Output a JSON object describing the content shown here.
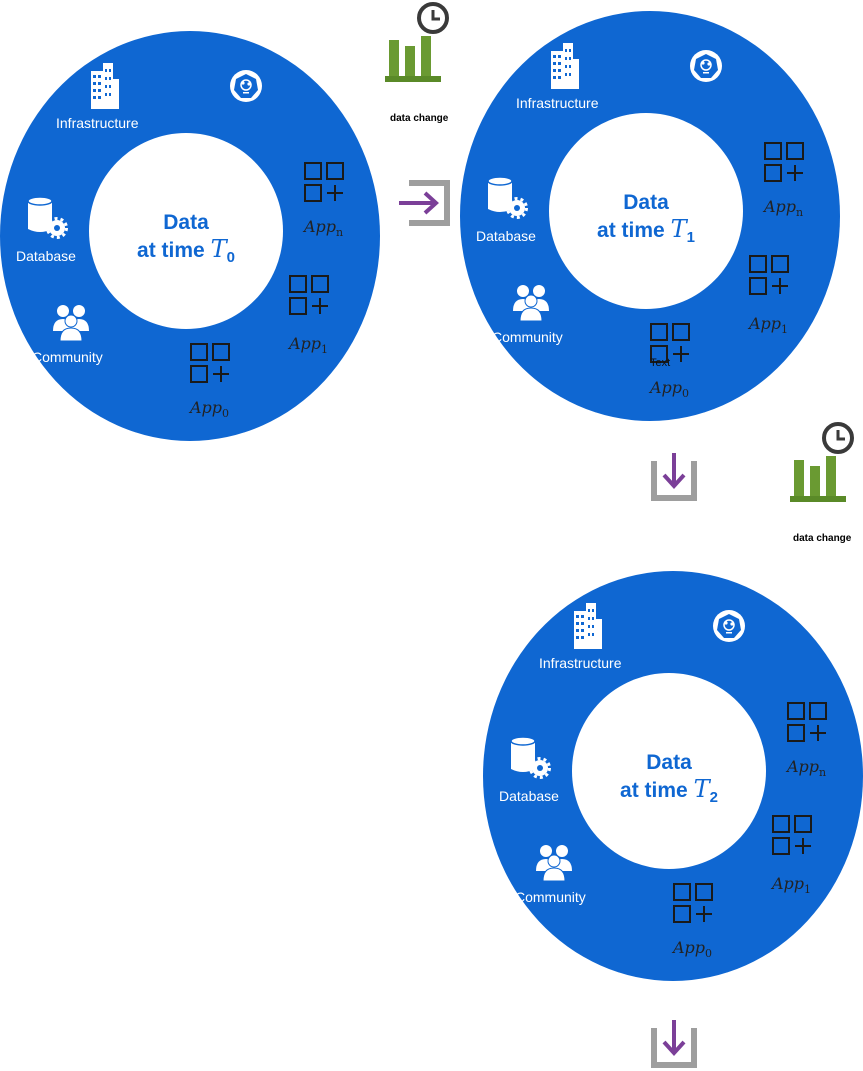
{
  "rings": [
    {
      "center_title": "Data",
      "center_line2": "at time",
      "time_var": "T",
      "time_sub": "0",
      "infrastructure": "Infrastructure",
      "database": "Database",
      "community": "Community",
      "apps": [
        {
          "base": "App",
          "sub": "n"
        },
        {
          "base": "App",
          "sub": "1"
        },
        {
          "base": "App",
          "sub": "0"
        }
      ]
    },
    {
      "center_title": "Data",
      "center_line2": "at time",
      "time_var": "T",
      "time_sub": "1",
      "infrastructure": "Infrastructure",
      "database": "Database",
      "community": "Community",
      "apps": [
        {
          "base": "App",
          "sub": "n"
        },
        {
          "base": "App",
          "sub": "1"
        },
        {
          "base": "App",
          "sub": "0"
        }
      ]
    },
    {
      "center_title": "Data",
      "center_line2": "at time",
      "time_var": "T",
      "time_sub": "2",
      "infrastructure": "Infrastructure",
      "database": "Database",
      "community": "Community",
      "apps": [
        {
          "base": "App",
          "sub": "n"
        },
        {
          "base": "App",
          "sub": "1"
        },
        {
          "base": "App",
          "sub": "0"
        }
      ]
    }
  ],
  "data_change_labels": [
    "data change",
    "data change"
  ],
  "stray_text": "Text",
  "colors": {
    "ring": "#0f67d2",
    "bars": "#6a9a32",
    "arrow": "#7b3f98",
    "bracket": "#9e9e9e"
  },
  "icons": [
    "building-icon",
    "kubernetes-icon",
    "database-gear-icon",
    "community-icon",
    "app-grid-icon",
    "bar-chart-clock-icon",
    "import-arrow-icon"
  ]
}
